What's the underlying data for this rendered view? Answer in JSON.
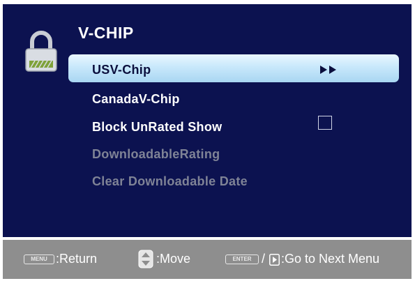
{
  "osd": {
    "title": "V-CHIP",
    "lock_icon": "padlock-icon",
    "items": [
      {
        "label": "USV-Chip",
        "state": "selected",
        "indicator": "▶▶"
      },
      {
        "label": "CanadaV-Chip",
        "state": "enabled"
      },
      {
        "label": "Block UnRated Show",
        "state": "enabled",
        "checkbox": false
      },
      {
        "label": "DownloadableRating",
        "state": "disabled"
      },
      {
        "label": "Clear Downloadable Date",
        "state": "disabled"
      }
    ]
  },
  "footer": {
    "menu_key": "MENU",
    "return_label": ":Return",
    "move_icon": "up-down-icon",
    "move_label": ":Move",
    "enter_key": "ENTER",
    "slash": "/",
    "right_icon": "right-key-icon",
    "next_label": ":Go to Next Menu"
  },
  "colors": {
    "osd_background": "#0c1250",
    "selected_highlight": "#b9def5",
    "footer_background": "#8e8e8e",
    "disabled_text": "#7f8396"
  }
}
